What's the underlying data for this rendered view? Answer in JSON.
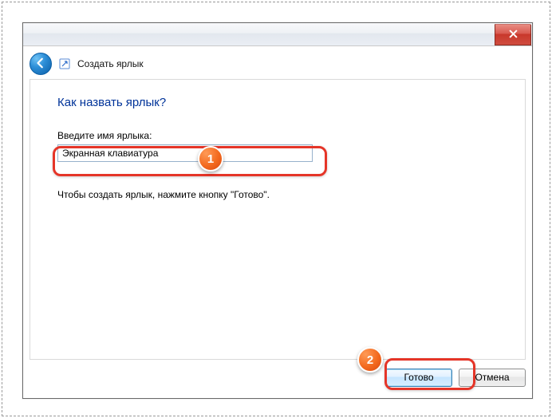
{
  "wizard_title": "Создать ярлык",
  "heading": "Как назвать ярлык?",
  "input_label": "Введите имя ярлыка:",
  "input_value": "Экранная клавиатура",
  "hint_text": "Чтобы создать ярлык, нажмите кнопку \"Готово\".",
  "finish_label": "Готово",
  "cancel_label": "Отмена",
  "markers": {
    "m1": "1",
    "m2": "2"
  },
  "icons": {
    "close": "close-icon",
    "back": "back-arrow-icon",
    "app": "shortcut-icon"
  }
}
